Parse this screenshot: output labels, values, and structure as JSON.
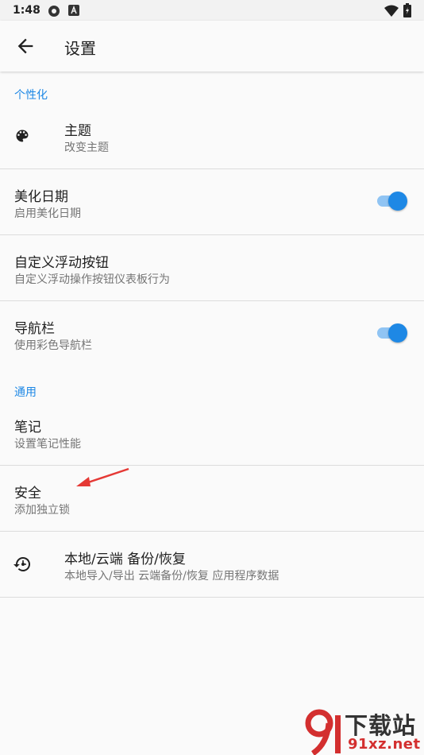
{
  "status_bar": {
    "time": "1:48",
    "left_icons": [
      "settings-status-icon",
      "a-status-icon"
    ],
    "right_icons": [
      "wifi-icon",
      "battery-icon"
    ]
  },
  "appbar": {
    "title": "设置",
    "back_icon": "arrow-back-icon"
  },
  "sections": {
    "personalize": "个性化",
    "general": "通用"
  },
  "items": {
    "theme": {
      "title": "主题",
      "subtitle": "改变主题",
      "icon": "palette-icon"
    },
    "beautify_date": {
      "title": "美化日期",
      "subtitle": "启用美化日期",
      "switch_on": true
    },
    "custom_fab": {
      "title": "自定义浮动按钮",
      "subtitle": "自定义浮动操作按钮仪表板行为"
    },
    "nav_bar": {
      "title": "导航栏",
      "subtitle": "使用彩色导航栏",
      "switch_on": true
    },
    "notes": {
      "title": "笔记",
      "subtitle": "设置笔记性能"
    },
    "security": {
      "title": "安全",
      "subtitle": "添加独立锁"
    },
    "backup": {
      "title": "本地/云端 备份/恢复",
      "subtitle": "本地导入/导出 云端备份/恢复 应用程序数据",
      "icon": "backup-restore-icon"
    }
  },
  "colors": {
    "accent": "#1e88e5",
    "track": "#90c4f3",
    "annotation_arrow": "#e53935"
  },
  "watermark": {
    "top": "下载站",
    "bottom": "91xz.net"
  }
}
